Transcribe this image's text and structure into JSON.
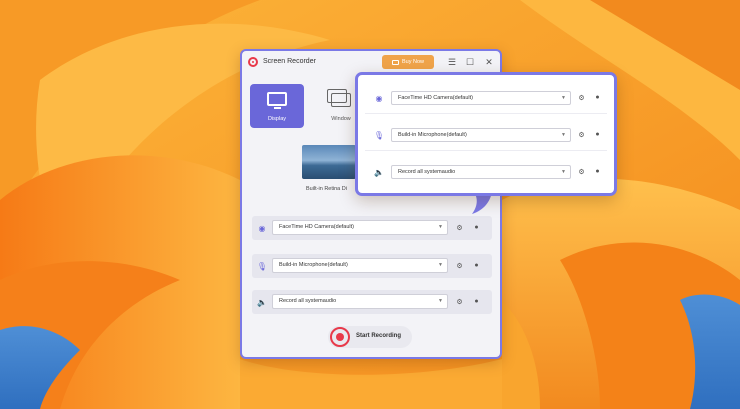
{
  "window": {
    "title": "Screen Recorder",
    "buy_label": "Buy Now",
    "controls": {
      "menu": "☰",
      "maximize": "☐",
      "close": "✕"
    }
  },
  "modes": [
    {
      "label": "Display",
      "active": true
    },
    {
      "label": "Window",
      "active": false
    }
  ],
  "preview": {
    "label": "Built-in Retina Di"
  },
  "devices": [
    {
      "icon": "camera-icon",
      "glyph": "◉",
      "value": "FaceTime HD Camera(default)"
    },
    {
      "icon": "microphone-icon",
      "glyph": "🎙",
      "value": "Build-in Microphone(default)"
    },
    {
      "icon": "speaker-icon",
      "glyph": "🔈",
      "value": "Record all systemaudio"
    }
  ],
  "callout_devices": [
    {
      "icon": "camera-icon",
      "glyph": "◉",
      "value": "FaceTime HD Camera(default)"
    },
    {
      "icon": "microphone-icon",
      "glyph": "🎙",
      "value": "Build-in Microphone(default)"
    },
    {
      "icon": "speaker-icon",
      "glyph": "🔈",
      "value": "Record all systemaudio"
    }
  ],
  "record": {
    "label": "Start Recording"
  },
  "colors": {
    "accent": "#6a67d9",
    "border": "#7b79e6",
    "record": "#e8394a",
    "buy": "#f0a44a"
  }
}
